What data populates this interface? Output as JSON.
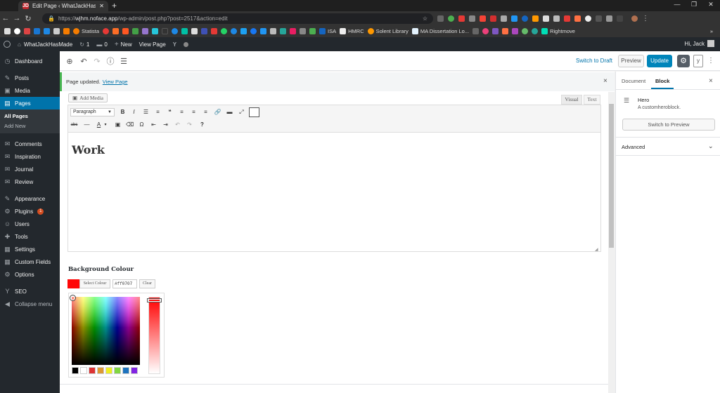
{
  "browser": {
    "tab_title": "Edit Page ‹ WhatJackHasMade — ",
    "tab_favicon": "JD",
    "new_tab": "+",
    "url_host": "wjhm.noface.app",
    "url_scheme": "https://",
    "url_path": "/wp-admin/post.php?post=2517&action=edit",
    "bookmarks": [
      "Statista",
      "ISA",
      "HMRC",
      "Solent Library",
      "MA Dissertation Lo...",
      "Rightmove"
    ],
    "bookmarks_more": "»"
  },
  "adminbar": {
    "site_name": "WhatJackHasMade",
    "updates_count": "1",
    "comments_count": "0",
    "new_label": "New",
    "view_page": "View Page",
    "howdy": "Hi, Jack"
  },
  "sidebar": {
    "items": [
      {
        "label": "Dashboard",
        "icon": "dashboard-icon",
        "glyph": "◷"
      },
      {
        "label": "Posts",
        "icon": "pin-icon",
        "glyph": "✎"
      },
      {
        "label": "Media",
        "icon": "media-icon",
        "glyph": "▣"
      },
      {
        "label": "Pages",
        "icon": "pages-icon",
        "glyph": "▤"
      },
      {
        "label": "Comments",
        "icon": "comments-icon",
        "glyph": "✉"
      },
      {
        "label": "Inspiration",
        "icon": "comment-icon",
        "glyph": "✉"
      },
      {
        "label": "Journal",
        "icon": "comment-icon",
        "glyph": "✉"
      },
      {
        "label": "Review",
        "icon": "comment-icon",
        "glyph": "✉"
      },
      {
        "label": "Appearance",
        "icon": "brush-icon",
        "glyph": "✎"
      },
      {
        "label": "Plugins",
        "icon": "plugin-icon",
        "glyph": "⚙",
        "badge": "1"
      },
      {
        "label": "Users",
        "icon": "users-icon",
        "glyph": "☺"
      },
      {
        "label": "Tools",
        "icon": "tools-icon",
        "glyph": "✚"
      },
      {
        "label": "Settings",
        "icon": "settings-icon",
        "glyph": "▦"
      },
      {
        "label": "Custom Fields",
        "icon": "fields-icon",
        "glyph": "▦"
      },
      {
        "label": "Options",
        "icon": "options-icon",
        "glyph": "⚙"
      },
      {
        "label": "SEO",
        "icon": "yoast-icon",
        "glyph": "Y"
      },
      {
        "label": "Collapse menu",
        "icon": "collapse-icon",
        "glyph": "◀"
      }
    ],
    "pages_sub": [
      "All Pages",
      "Add New"
    ]
  },
  "editor_header": {
    "switch_to_draft": "Switch to Draft",
    "preview": "Preview",
    "update": "Update",
    "yoast": "y",
    "more": "⋮"
  },
  "notice": {
    "text": "Page updated.",
    "link": "View Page",
    "close": "×"
  },
  "content_editor": {
    "add_media": "Add Media",
    "tab_visual": "Visual",
    "tab_text": "Text",
    "format": "Paragraph",
    "toolbar_row1": [
      "B",
      "I",
      "☰",
      "≡",
      "❝",
      "≡",
      "≡",
      "≡",
      "🔗",
      "▬",
      "⤢"
    ],
    "toolbar_row2": [
      "abc",
      "—",
      "A",
      "▾",
      "▣",
      "⌫",
      "Ω",
      "⇤",
      "⇥",
      "↶",
      "↷",
      "?"
    ],
    "heading": "Work"
  },
  "background_colour": {
    "label": "Background Colour",
    "select_colour": "Select Colour",
    "hex_value": "#ff0707",
    "clear": "Clear",
    "swatch_color": "#ff0707",
    "palette": [
      "#000000",
      "#ffffff",
      "#dd3333",
      "#dd9933",
      "#eeee22",
      "#81d742",
      "#1e73be",
      "#8224e3"
    ]
  },
  "panel": {
    "tab_document": "Document",
    "tab_block": "Block",
    "close": "×",
    "block_name": "Hero",
    "block_description": "A customheroblock.",
    "switch_to_preview": "Switch to Preview",
    "advanced": "Advanced"
  }
}
